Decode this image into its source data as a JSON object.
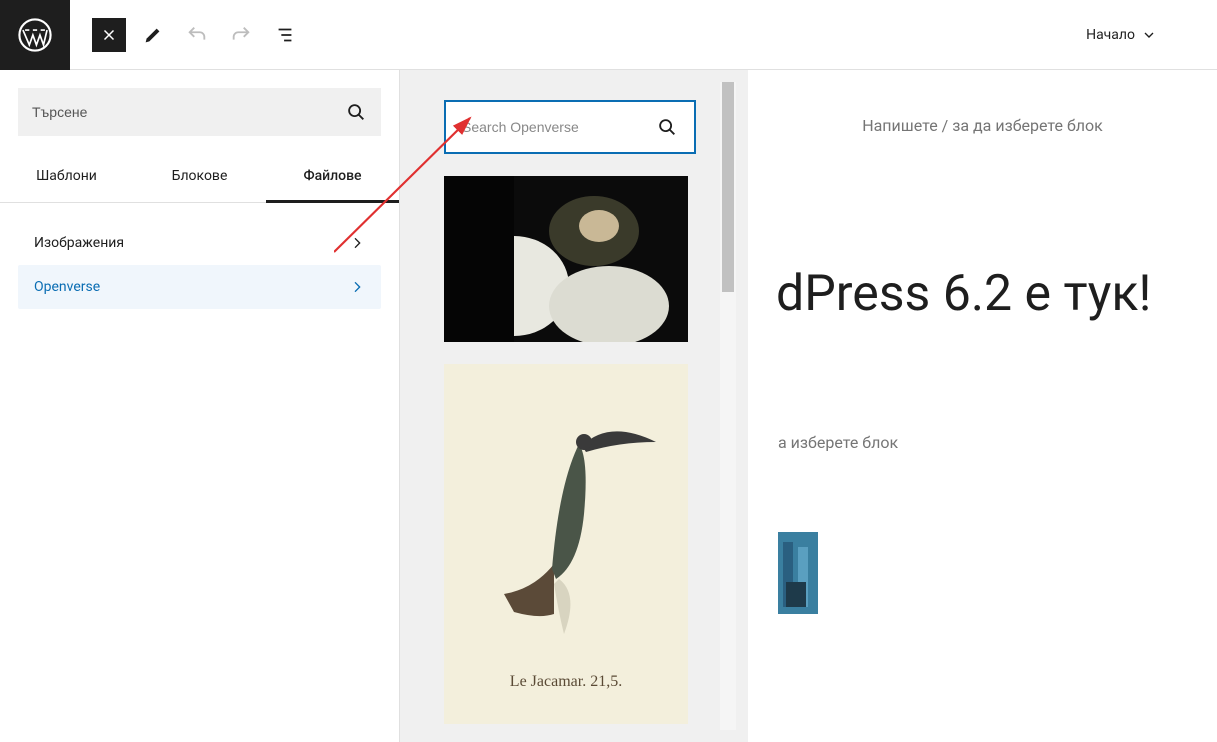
{
  "topbar": {
    "template_label": "Начало"
  },
  "sidebar": {
    "search_placeholder": "Търсене",
    "tabs": {
      "patterns": "Шаблони",
      "blocks": "Блокове",
      "media": "Файлове"
    },
    "categories": {
      "images": "Изображения",
      "openverse": "Openverse"
    }
  },
  "media_panel": {
    "search_placeholder": "Search Openverse",
    "thumb2_caption": "Le Jacamar. 21,5."
  },
  "content": {
    "placeholder1": "Напишете / за да изберете блок",
    "heading": "dPress 6.2 е тук!",
    "placeholder2": "а изберете блок"
  }
}
